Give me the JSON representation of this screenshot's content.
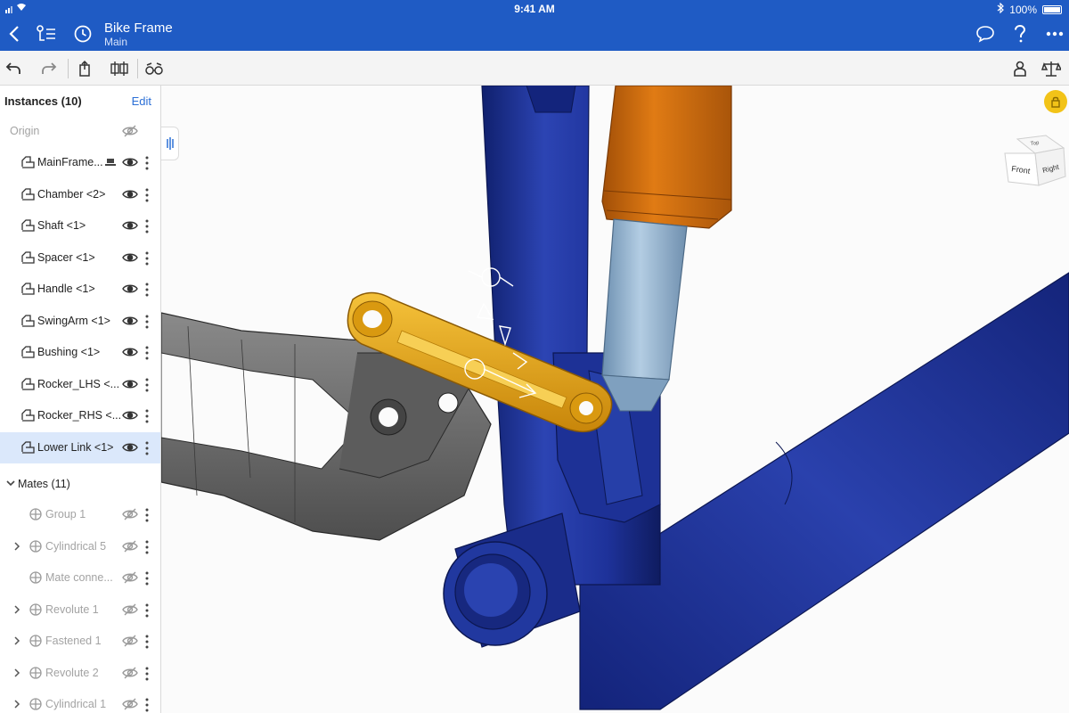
{
  "status": {
    "time": "9:41 AM",
    "battery": "100%"
  },
  "header": {
    "title": "Bike Frame",
    "subtitle": "Main"
  },
  "panel": {
    "title": "Instances (10)",
    "edit": "Edit",
    "origin": "Origin",
    "instances": [
      {
        "label": "MainFrame..."
      },
      {
        "label": "Chamber <2>"
      },
      {
        "label": "Shaft <1>"
      },
      {
        "label": "Spacer <1>"
      },
      {
        "label": "Handle <1>"
      },
      {
        "label": "SwingArm <1>"
      },
      {
        "label": "Bushing <1>"
      },
      {
        "label": "Rocker_LHS <..."
      },
      {
        "label": "Rocker_RHS <..."
      },
      {
        "label": "Lower Link <1>",
        "selected": true
      }
    ],
    "mates_title": "Mates (11)",
    "mates": [
      {
        "label": "Group 1",
        "icon": "group-icon"
      },
      {
        "label": "Cylindrical 5",
        "icon": "cylindrical-mate-icon"
      },
      {
        "label": "Mate conne...",
        "icon": "mate-connector-icon"
      },
      {
        "label": "Revolute 1",
        "icon": "revolute-mate-icon"
      },
      {
        "label": "Fastened 1",
        "icon": "fastened-mate-icon"
      },
      {
        "label": "Revolute 2",
        "icon": "revolute-mate-icon"
      },
      {
        "label": "Cylindrical 1",
        "icon": "cylindrical-mate-icon"
      }
    ]
  },
  "viewcube": {
    "front": "Front",
    "right": "Right",
    "top": "Top"
  },
  "colors": {
    "brand_blue": "#1f5bc4",
    "frame_blue": "#1c2f8f",
    "link_gold": "#e0a412",
    "shock_orange": "#d7700f",
    "shaft_blue": "#8fb2d0",
    "swingarm_gray": "#6d6d6d"
  }
}
